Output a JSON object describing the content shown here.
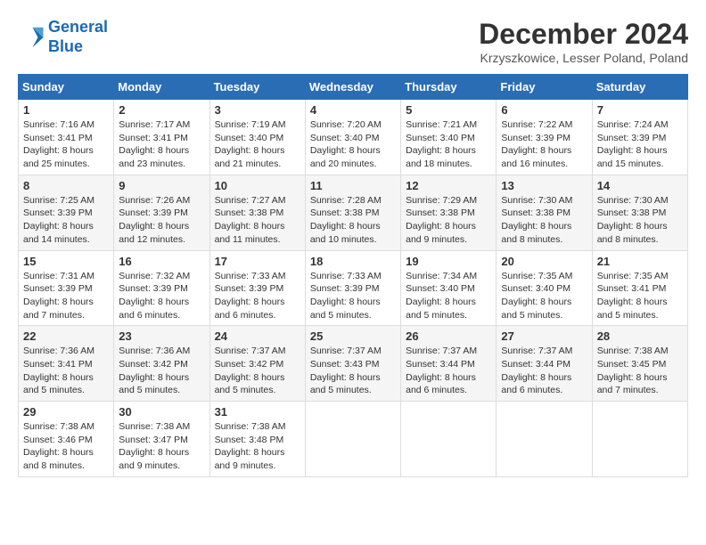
{
  "header": {
    "logo_line1": "General",
    "logo_line2": "Blue",
    "month": "December 2024",
    "location": "Krzyszkowice, Lesser Poland, Poland"
  },
  "days_of_week": [
    "Sunday",
    "Monday",
    "Tuesday",
    "Wednesday",
    "Thursday",
    "Friday",
    "Saturday"
  ],
  "weeks": [
    [
      {
        "day": "1",
        "sunrise": "7:16 AM",
        "sunset": "3:41 PM",
        "daylight": "8 hours and 25 minutes."
      },
      {
        "day": "2",
        "sunrise": "7:17 AM",
        "sunset": "3:41 PM",
        "daylight": "8 hours and 23 minutes."
      },
      {
        "day": "3",
        "sunrise": "7:19 AM",
        "sunset": "3:40 PM",
        "daylight": "8 hours and 21 minutes."
      },
      {
        "day": "4",
        "sunrise": "7:20 AM",
        "sunset": "3:40 PM",
        "daylight": "8 hours and 20 minutes."
      },
      {
        "day": "5",
        "sunrise": "7:21 AM",
        "sunset": "3:40 PM",
        "daylight": "8 hours and 18 minutes."
      },
      {
        "day": "6",
        "sunrise": "7:22 AM",
        "sunset": "3:39 PM",
        "daylight": "8 hours and 16 minutes."
      },
      {
        "day": "7",
        "sunrise": "7:24 AM",
        "sunset": "3:39 PM",
        "daylight": "8 hours and 15 minutes."
      }
    ],
    [
      {
        "day": "8",
        "sunrise": "7:25 AM",
        "sunset": "3:39 PM",
        "daylight": "8 hours and 14 minutes."
      },
      {
        "day": "9",
        "sunrise": "7:26 AM",
        "sunset": "3:39 PM",
        "daylight": "8 hours and 12 minutes."
      },
      {
        "day": "10",
        "sunrise": "7:27 AM",
        "sunset": "3:38 PM",
        "daylight": "8 hours and 11 minutes."
      },
      {
        "day": "11",
        "sunrise": "7:28 AM",
        "sunset": "3:38 PM",
        "daylight": "8 hours and 10 minutes."
      },
      {
        "day": "12",
        "sunrise": "7:29 AM",
        "sunset": "3:38 PM",
        "daylight": "8 hours and 9 minutes."
      },
      {
        "day": "13",
        "sunrise": "7:30 AM",
        "sunset": "3:38 PM",
        "daylight": "8 hours and 8 minutes."
      },
      {
        "day": "14",
        "sunrise": "7:30 AM",
        "sunset": "3:38 PM",
        "daylight": "8 hours and 8 minutes."
      }
    ],
    [
      {
        "day": "15",
        "sunrise": "7:31 AM",
        "sunset": "3:39 PM",
        "daylight": "8 hours and 7 minutes."
      },
      {
        "day": "16",
        "sunrise": "7:32 AM",
        "sunset": "3:39 PM",
        "daylight": "8 hours and 6 minutes."
      },
      {
        "day": "17",
        "sunrise": "7:33 AM",
        "sunset": "3:39 PM",
        "daylight": "8 hours and 6 minutes."
      },
      {
        "day": "18",
        "sunrise": "7:33 AM",
        "sunset": "3:39 PM",
        "daylight": "8 hours and 5 minutes."
      },
      {
        "day": "19",
        "sunrise": "7:34 AM",
        "sunset": "3:40 PM",
        "daylight": "8 hours and 5 minutes."
      },
      {
        "day": "20",
        "sunrise": "7:35 AM",
        "sunset": "3:40 PM",
        "daylight": "8 hours and 5 minutes."
      },
      {
        "day": "21",
        "sunrise": "7:35 AM",
        "sunset": "3:41 PM",
        "daylight": "8 hours and 5 minutes."
      }
    ],
    [
      {
        "day": "22",
        "sunrise": "7:36 AM",
        "sunset": "3:41 PM",
        "daylight": "8 hours and 5 minutes."
      },
      {
        "day": "23",
        "sunrise": "7:36 AM",
        "sunset": "3:42 PM",
        "daylight": "8 hours and 5 minutes."
      },
      {
        "day": "24",
        "sunrise": "7:37 AM",
        "sunset": "3:42 PM",
        "daylight": "8 hours and 5 minutes."
      },
      {
        "day": "25",
        "sunrise": "7:37 AM",
        "sunset": "3:43 PM",
        "daylight": "8 hours and 5 minutes."
      },
      {
        "day": "26",
        "sunrise": "7:37 AM",
        "sunset": "3:44 PM",
        "daylight": "8 hours and 6 minutes."
      },
      {
        "day": "27",
        "sunrise": "7:37 AM",
        "sunset": "3:44 PM",
        "daylight": "8 hours and 6 minutes."
      },
      {
        "day": "28",
        "sunrise": "7:38 AM",
        "sunset": "3:45 PM",
        "daylight": "8 hours and 7 minutes."
      }
    ],
    [
      {
        "day": "29",
        "sunrise": "7:38 AM",
        "sunset": "3:46 PM",
        "daylight": "8 hours and 8 minutes."
      },
      {
        "day": "30",
        "sunrise": "7:38 AM",
        "sunset": "3:47 PM",
        "daylight": "8 hours and 9 minutes."
      },
      {
        "day": "31",
        "sunrise": "7:38 AM",
        "sunset": "3:48 PM",
        "daylight": "8 hours and 9 minutes."
      },
      null,
      null,
      null,
      null
    ]
  ]
}
